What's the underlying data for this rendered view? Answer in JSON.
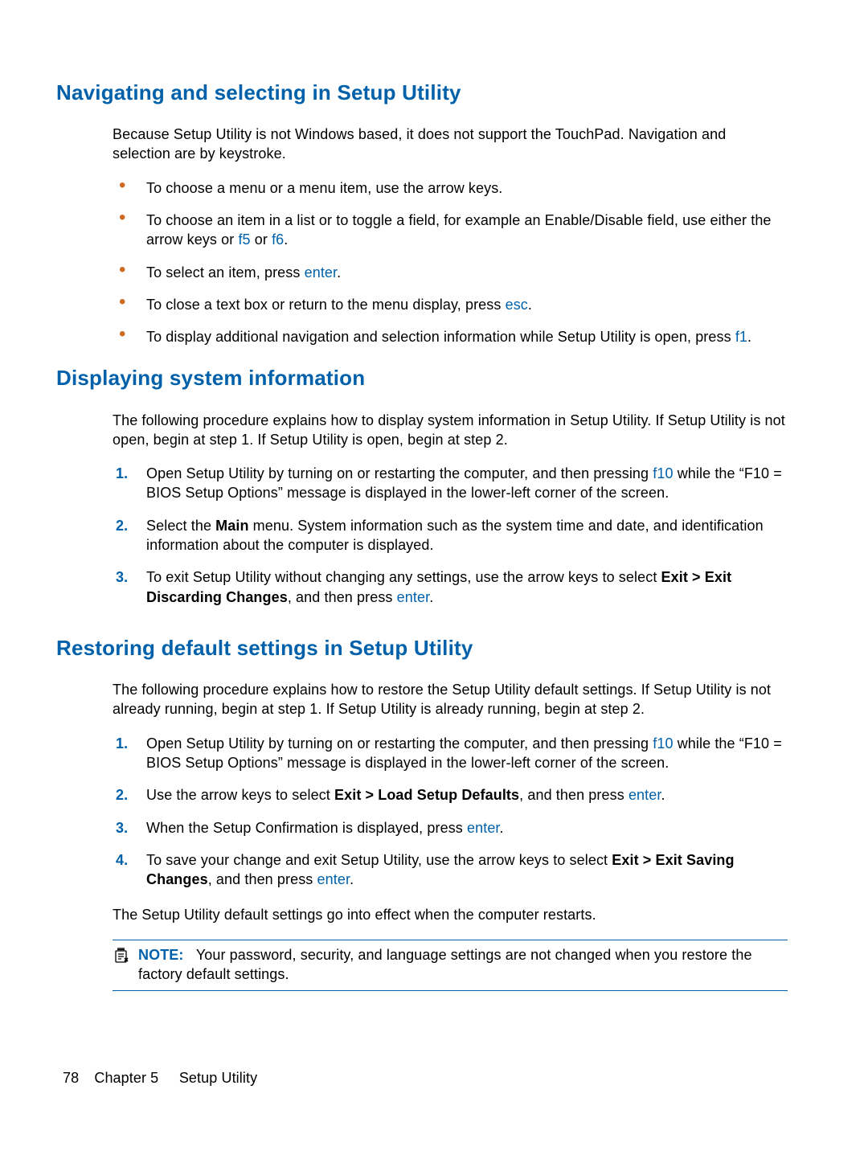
{
  "footer": {
    "page_number": "78",
    "chapter_label": "Chapter 5",
    "chapter_title": "Setup Utility"
  },
  "sections": [
    {
      "heading": "Navigating and selecting in Setup Utility",
      "intro": "Because Setup Utility is not Windows based, it does not support the TouchPad. Navigation and selection are by keystroke.",
      "bullets": [
        {
          "pre": "To choose a menu or a menu item, use the arrow keys."
        },
        {
          "pre": "To choose an item in a list or to toggle a field, for example an Enable/Disable field, use either the arrow keys or ",
          "k1": "f5",
          "mid": " or ",
          "k2": "f6",
          "post": "."
        },
        {
          "pre": "To select an item, press ",
          "k1": "enter",
          "post": "."
        },
        {
          "pre": "To close a text box or return to the menu display, press ",
          "k1": "esc",
          "post": "."
        },
        {
          "pre": "To display additional navigation and selection information while Setup Utility is open, press ",
          "k1": "f1",
          "post": "."
        }
      ]
    },
    {
      "heading": "Displaying system information",
      "intro": "The following procedure explains how to display system information in Setup Utility. If Setup Utility is not open, begin at step 1. If Setup Utility is open, begin at step 2.",
      "steps": [
        {
          "pre": "Open Setup Utility by turning on or restarting the computer, and then pressing ",
          "k1": "f10",
          "post": " while the “F10 = BIOS Setup Options” message is displayed in the lower-left corner of the screen."
        },
        {
          "pre": "Select the ",
          "b1": "Main",
          "post": " menu. System information such as the system time and date, and identification information about the computer is displayed."
        },
        {
          "pre": "To exit Setup Utility without changing any settings, use the arrow keys to select ",
          "b1": "Exit > Exit Discarding Changes",
          "mid": ", and then press ",
          "k1": "enter",
          "post": "."
        }
      ]
    },
    {
      "heading": "Restoring default settings in Setup Utility",
      "intro": "The following procedure explains how to restore the Setup Utility default settings. If Setup Utility is not already running, begin at step 1. If Setup Utility is already running, begin at step 2.",
      "steps": [
        {
          "pre": "Open Setup Utility by turning on or restarting the computer, and then pressing ",
          "k1": "f10",
          "post": " while the “F10 = BIOS Setup Options” message is displayed in the lower-left corner of the screen."
        },
        {
          "pre": "Use the arrow keys to select ",
          "b1": "Exit > Load Setup Defaults",
          "mid": ", and then press ",
          "k1": "enter",
          "post": "."
        },
        {
          "pre": "When the Setup Confirmation is displayed, press ",
          "k1": "enter",
          "post": "."
        },
        {
          "pre": "To save your change and exit Setup Utility, use the arrow keys to select ",
          "b1": "Exit > Exit Saving Changes",
          "mid": ", and then press ",
          "k1": "enter",
          "post": "."
        }
      ],
      "outro": "The Setup Utility default settings go into effect when the computer restarts.",
      "note": {
        "label": "NOTE:",
        "text": "Your password, security, and language settings are not changed when you restore the factory default settings."
      }
    }
  ]
}
